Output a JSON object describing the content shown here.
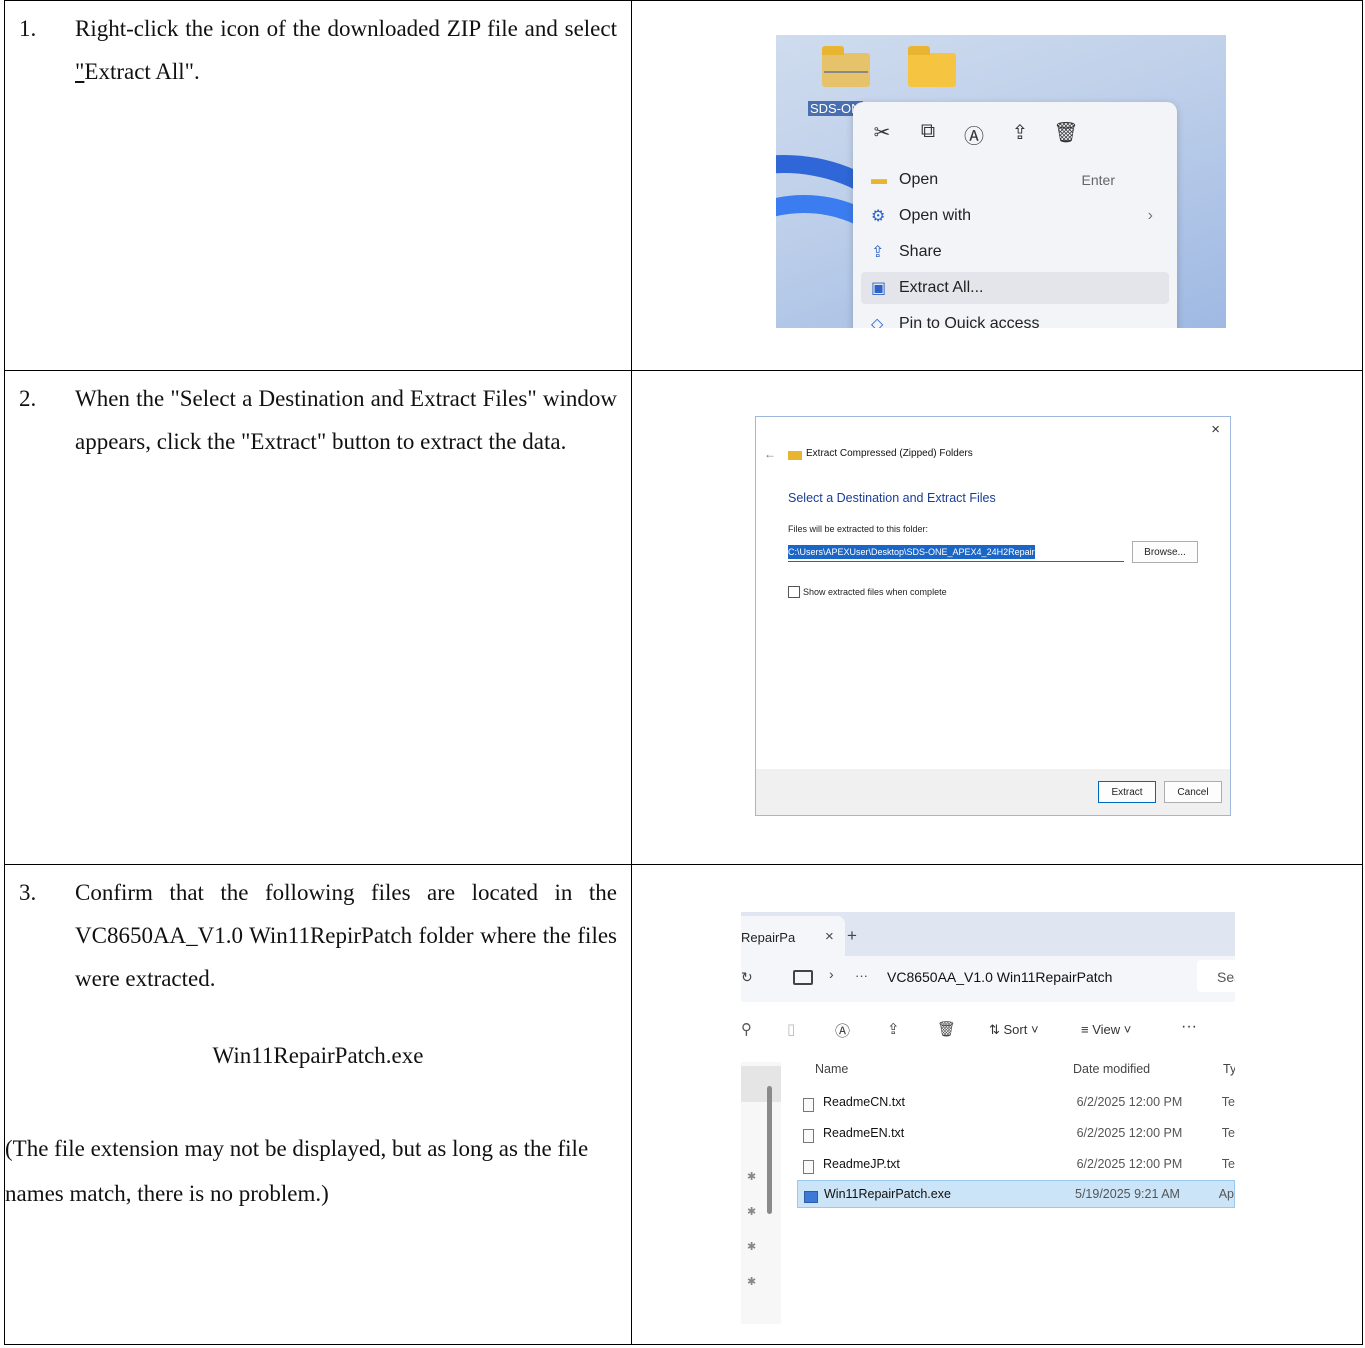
{
  "steps": [
    {
      "num": "1.",
      "text_pre": "Right-click the icon of the downloaded ZIP file and select ",
      "text_underlined": "\"",
      "text_post": "Extract All\"."
    },
    {
      "num": "2.",
      "text": "When the \"Select a Destination and Extract Files\" window appears, click the \"Extract\" button to extract the data."
    },
    {
      "num": "3.",
      "text": "Confirm that the following files are located in the VC8650AA_V1.0 Win11RepirPatch folder where the files were extracted.",
      "filename": "Win11RepairPatch.exe",
      "note": "(The file extension may not be displayed, but as long as the file names match, there is no problem.)"
    }
  ],
  "shot1": {
    "folder_label": "SDS-ON",
    "menu": [
      {
        "label": "Open",
        "shortcut": "Enter"
      },
      {
        "label": "Open with",
        "arrow": "›"
      },
      {
        "label": "Share"
      },
      {
        "label": "Extract All...",
        "selected": true
      },
      {
        "label": "Pin to Quick access"
      }
    ]
  },
  "shot2": {
    "close": "×",
    "back": "←",
    "window_title": "Extract Compressed (Zipped) Folders",
    "heading": "Select a Destination and Extract Files",
    "path_label": "Files will be extracted to this folder:",
    "path_value": "C:\\Users\\APEXUser\\Desktop\\SDS-ONE_APEX4_24H2Repair",
    "browse": "Browse...",
    "checkbox_label": "Show extracted files when complete",
    "extract": "Extract",
    "cancel": "Cancel"
  },
  "shot3": {
    "tab_label": "RepairPa",
    "tab_close": "×",
    "tab_add": "+",
    "breadcrumb_sep": "›",
    "breadcrumb_more": "···",
    "folder": "VC8650AA_V1.0 Win11RepairPatch",
    "search": "Sea",
    "sort": "Sort",
    "view": "View",
    "more": "···",
    "col_name": "Name",
    "col_date": "Date modified",
    "col_type": "Ty",
    "files": [
      {
        "name": "ReadmeCN.txt",
        "date": "6/2/2025 12:00 PM",
        "type": "Te"
      },
      {
        "name": "ReadmeEN.txt",
        "date": "6/2/2025 12:00 PM",
        "type": "Te"
      },
      {
        "name": "ReadmeJP.txt",
        "date": "6/2/2025 12:00 PM",
        "type": "Te"
      },
      {
        "name": "Win11RepairPatch.exe",
        "date": "5/19/2025 9:21 AM",
        "type": "Ap"
      }
    ]
  }
}
